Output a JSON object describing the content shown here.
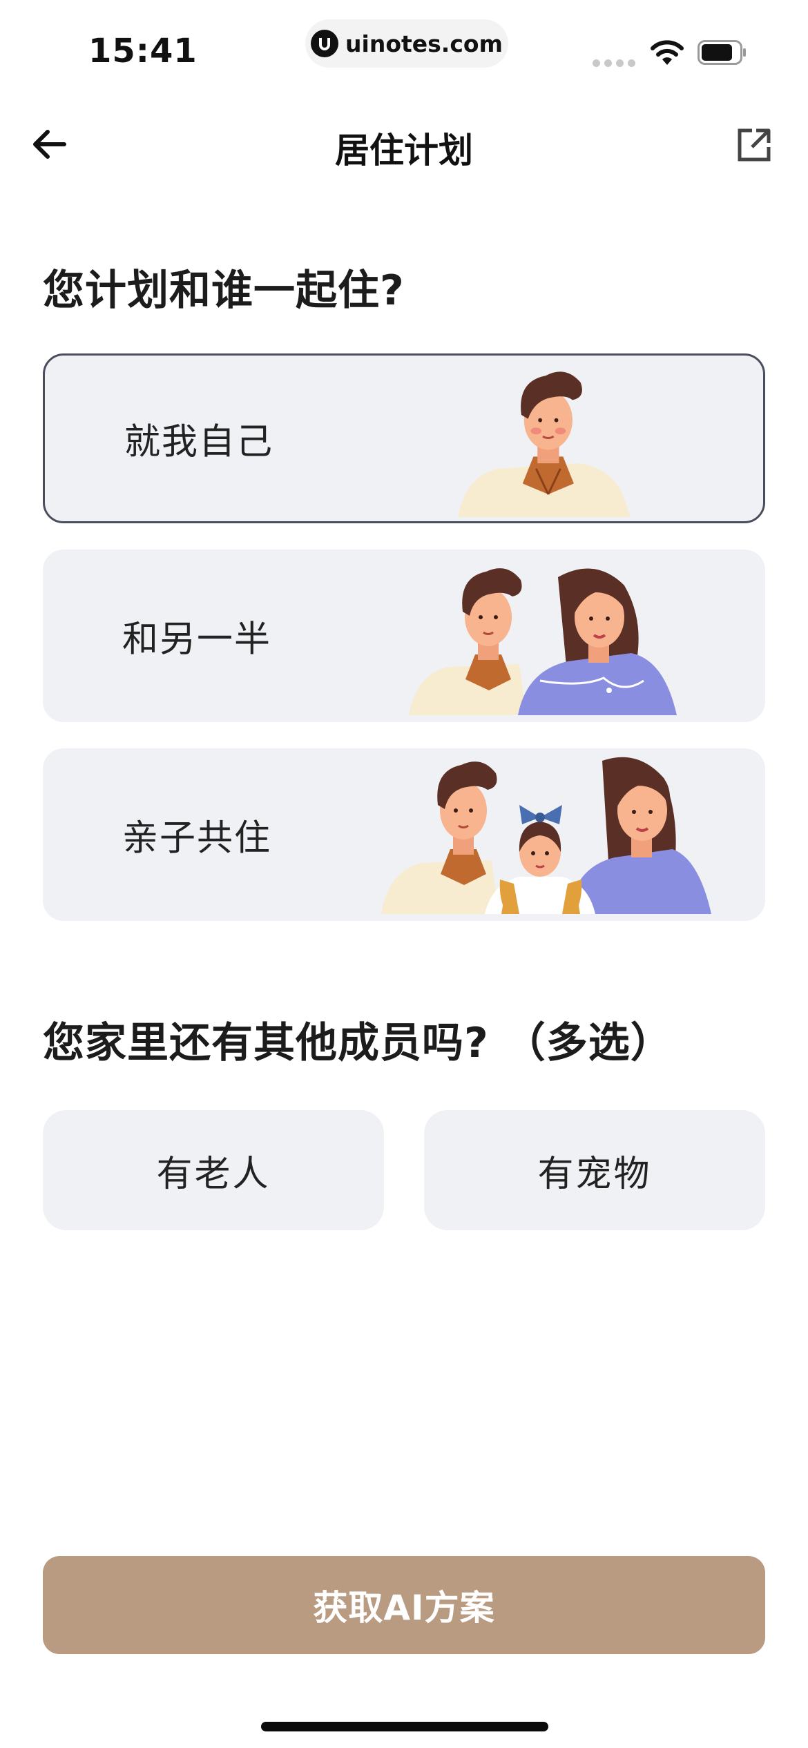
{
  "status_bar": {
    "time": "15:41",
    "url": "uinotes.com"
  },
  "nav": {
    "title": "居住计划",
    "back_icon": "arrow-left-icon",
    "share_icon": "open-external-icon"
  },
  "section_live_with": {
    "question": "您计划和谁一起住?",
    "options": [
      {
        "label": "就我自己",
        "selected": true
      },
      {
        "label": "和另一半",
        "selected": false
      },
      {
        "label": "亲子共住",
        "selected": false
      }
    ]
  },
  "section_members": {
    "question": "您家里还有其他成员吗? （多选）",
    "options": [
      {
        "label": "有老人"
      },
      {
        "label": "有宠物"
      }
    ]
  },
  "cta": {
    "label": "获取AI方案"
  },
  "colors": {
    "card_bg": "#f0f1f5",
    "selected_border": "#4a4d5c",
    "cta_bg": "#b89b80",
    "shirt_cream": "#f7ecd0",
    "dress_purple": "#8a8ee0",
    "hair_brown": "#5a2f25"
  }
}
